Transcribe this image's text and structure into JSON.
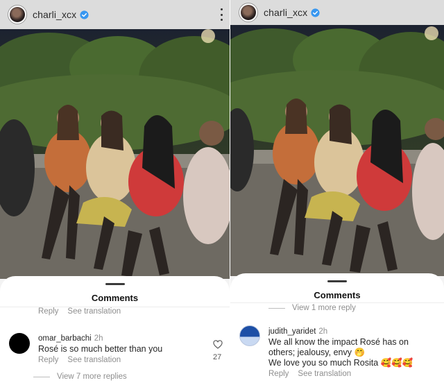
{
  "left": {
    "header": {
      "username": "charli_xcx"
    },
    "sheet": {
      "title": "Comments",
      "top_reply_label": "Reply",
      "top_translation_label": "See translation",
      "comment": {
        "username": "omar_barbachi",
        "time": "2h",
        "text": "Rosé is so much better than you",
        "reply_label": "Reply",
        "translation_label": "See translation",
        "like_count": "27"
      },
      "view_more_replies": "View 7 more replies"
    }
  },
  "right": {
    "header": {
      "username": "charli_xcx"
    },
    "sheet": {
      "title": "Comments",
      "view_more_reply": "View 1 more reply",
      "comment": {
        "username": "judith_yaridet",
        "time": "2h",
        "line1": "We all know the impact Rosé has on",
        "line2": "others; jealousy, envy 🤭",
        "line3": "We love you so much Rosita 🥰🥰🥰",
        "reply_label": "Reply",
        "translation_label": "See translation"
      }
    }
  },
  "colors": {
    "verified_badge": "#3897f0",
    "muted_text": "#8e8e8e",
    "header_bg": "#dcdcdc"
  },
  "icons": [
    "verified-badge-icon",
    "more-options-icon",
    "heart-icon"
  ]
}
